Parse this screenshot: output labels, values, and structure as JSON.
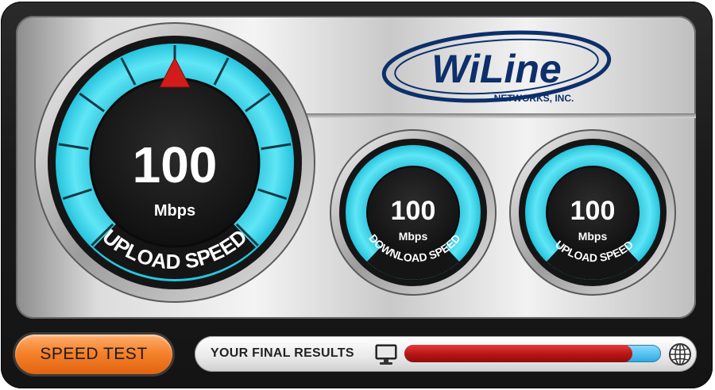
{
  "brand": {
    "name": "WiLine",
    "subtitle": "NETWORKS, INC.",
    "color": "#0d2f6b"
  },
  "main_gauge": {
    "value": "100",
    "unit": "Mbps",
    "caption": "UPLOAD SPEED"
  },
  "download_gauge": {
    "value": "100",
    "unit": "Mbps",
    "caption": "DOWNLOAD SPEED"
  },
  "upload_gauge": {
    "value": "100",
    "unit": "Mbps",
    "caption": "UPLOAD SPEED"
  },
  "controls": {
    "speed_test_label": "SPEED TEST",
    "results_label": "YOUR FINAL RESULTS",
    "progress_fraction": 0.89
  },
  "colors": {
    "gauge_cyan": "#30d6ee",
    "needle_red": "#d21c1c",
    "button_orange": "#f5822c",
    "progress_red": "#b81414",
    "progress_blue": "#2ba8e0"
  },
  "icons": [
    "monitor-icon",
    "globe-icon",
    "needle-icon"
  ]
}
